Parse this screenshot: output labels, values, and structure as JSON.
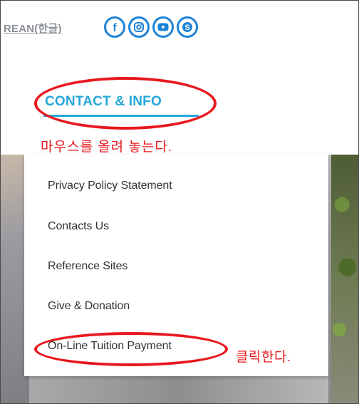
{
  "header": {
    "language_link": "REAN(한글)",
    "social": [
      {
        "name": "facebook-icon",
        "glyph": "f"
      },
      {
        "name": "instagram-icon"
      },
      {
        "name": "youtube-icon"
      },
      {
        "name": "skype-icon",
        "glyph": "S"
      }
    ],
    "accent_color": "#1e83d6"
  },
  "nav": {
    "active_label": "CONTACT & INFO",
    "active_color": "#25a7d8"
  },
  "annotations": {
    "hover_text": "마우스를 올려 놓는다.",
    "click_text": "클릭한다.",
    "color": "#e8181e"
  },
  "dropdown": {
    "items": [
      {
        "label": "Privacy Policy Statement"
      },
      {
        "label": "Contacts Us"
      },
      {
        "label": "Reference Sites"
      },
      {
        "label": "Give & Donation"
      },
      {
        "label": "On-Line Tuition Payment"
      }
    ]
  }
}
